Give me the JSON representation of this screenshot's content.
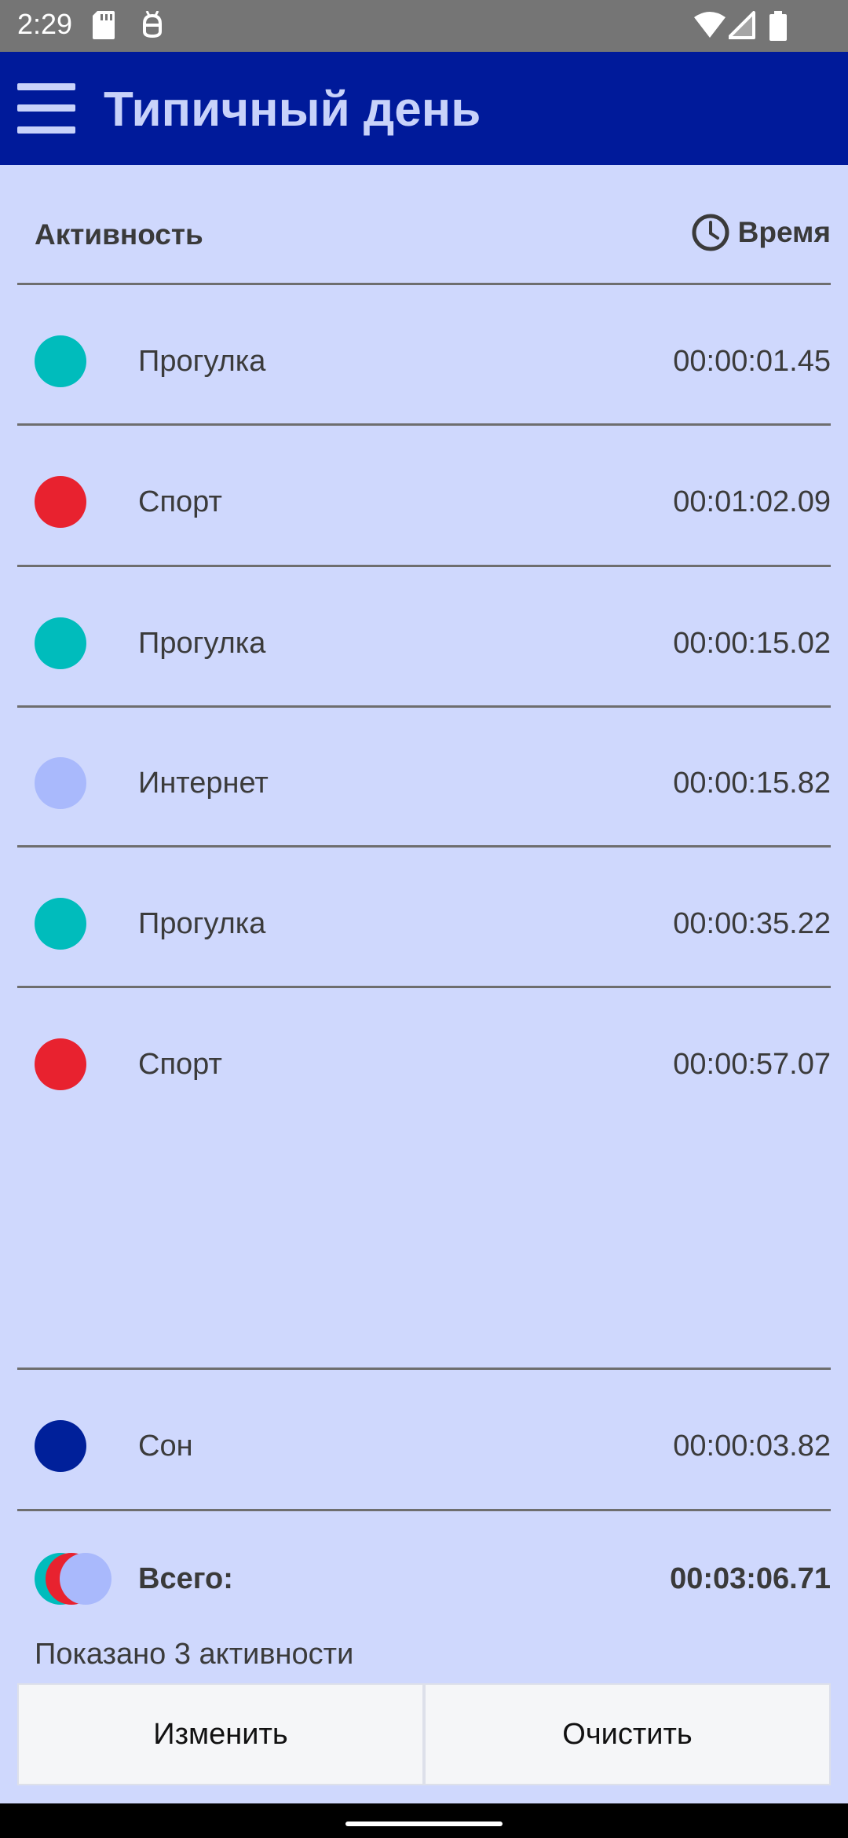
{
  "status_bar": {
    "time": "2:29"
  },
  "app_bar": {
    "title": "Типичный день"
  },
  "header": {
    "activity_label": "Активность",
    "time_label": "Время"
  },
  "rows": [
    {
      "name": "Прогулка",
      "time": "00:00:01.45",
      "color": "#00bcbc"
    },
    {
      "name": "Спорт",
      "time": "00:01:02.09",
      "color": "#e8222f"
    },
    {
      "name": "Прогулка",
      "time": "00:00:15.02",
      "color": "#00bcbc"
    },
    {
      "name": "Интернет",
      "time": "00:00:15.82",
      "color": "#a9b9fc"
    },
    {
      "name": "Прогулка",
      "time": "00:00:35.22",
      "color": "#00bcbc"
    },
    {
      "name": "Спорт",
      "time": "00:00:57.07",
      "color": "#e8222f"
    }
  ],
  "sleep_row": {
    "name": "Сон",
    "time": "00:00:03.82",
    "color": "#00209a"
  },
  "total": {
    "label": "Всего:",
    "time": "00:03:06.71"
  },
  "shown_count": "Показано 3 активности",
  "buttons": {
    "edit": "Изменить",
    "clear": "Очистить"
  },
  "colors": {
    "app_bar": "#001a9a",
    "background": "#cfd8fd",
    "walk": "#00bcbc",
    "sport": "#e8222f",
    "internet": "#a9b9fc",
    "sleep": "#00209a"
  },
  "icons": [
    "menu-icon",
    "clock-icon",
    "sd-card-icon",
    "android-debug-icon",
    "wifi-icon",
    "signal-icon",
    "battery-icon"
  ]
}
